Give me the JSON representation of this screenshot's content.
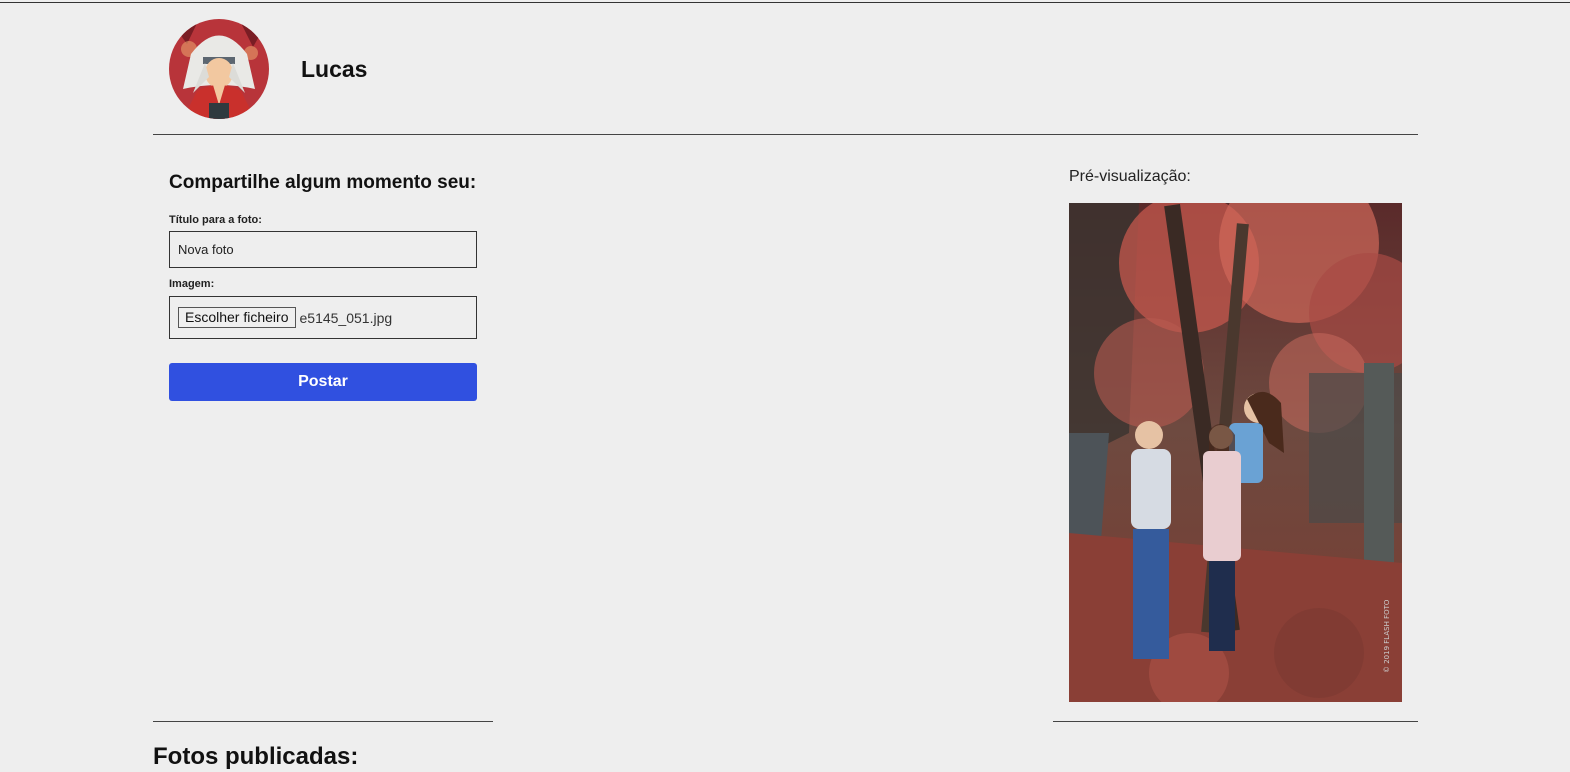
{
  "profile": {
    "username": "Lucas",
    "avatar_icon": "avatar-illustration"
  },
  "form": {
    "heading": "Compartilhe algum momento seu:",
    "title_label": "Título para a foto:",
    "title_value": "Nova foto",
    "image_label": "Imagem:",
    "file_button_label": "Escolher ficheiro",
    "file_name": "e5145_051.jpg",
    "submit_label": "Postar"
  },
  "preview": {
    "label": "Pré-visualização:"
  },
  "gallery": {
    "heading": "Fotos publicadas:"
  },
  "colors": {
    "background": "#eeeeee",
    "accent": "#3050e0"
  }
}
